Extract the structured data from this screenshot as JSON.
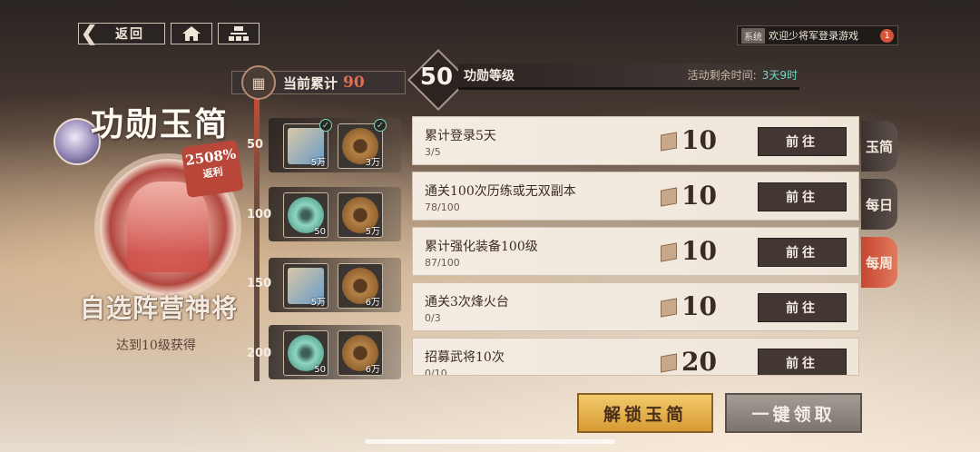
{
  "nav": {
    "back_label": "返回",
    "home_icon": "home-icon",
    "map_icon": "map-icon"
  },
  "notice": {
    "tag": "系统",
    "text": "欢迎少将军登录游戏",
    "badge": "1"
  },
  "event": {
    "title": "功勋玉简",
    "rebate_percent": "2508%",
    "rebate_label": "返利",
    "hero_name": "自选阵营神将",
    "hero_requirement": "达到10级获得"
  },
  "progress": {
    "label": "当前累计",
    "value": "90"
  },
  "levels": [
    {
      "level": "50",
      "rewards": [
        {
          "count": "5万",
          "icon": "scroll-icon",
          "claimed": true
        },
        {
          "count": "3万",
          "icon": "coin-icon",
          "claimed": true
        }
      ]
    },
    {
      "level": "100",
      "rewards": [
        {
          "count": "50",
          "icon": "jade-icon"
        },
        {
          "count": "5万",
          "icon": "coin-icon"
        }
      ]
    },
    {
      "level": "150",
      "rewards": [
        {
          "count": "5万",
          "icon": "scroll-icon"
        },
        {
          "count": "6万",
          "icon": "coin-icon"
        }
      ]
    },
    {
      "level": "200",
      "rewards": [
        {
          "count": "50",
          "icon": "jade-icon"
        },
        {
          "count": "6万",
          "icon": "coin-icon"
        }
      ]
    }
  ],
  "level_header": {
    "level": "50",
    "label": "功勋等级",
    "remain_label": "活动剩余时间:",
    "remain_value": "3天9时"
  },
  "tasks": [
    {
      "name": "累计登录5天",
      "progress": "3/5",
      "points": "10",
      "button": "前往"
    },
    {
      "name": "通关100次历练或无双副本",
      "progress": "78/100",
      "points": "10",
      "button": "前往"
    },
    {
      "name": "累计强化装备100级",
      "progress": "87/100",
      "points": "10",
      "button": "前往"
    },
    {
      "name": "通关3次烽火台",
      "progress": "0/3",
      "points": "10",
      "button": "前往"
    },
    {
      "name": "招募武将10次",
      "progress": "0/10",
      "points": "20",
      "button": "前往"
    }
  ],
  "tabs": [
    {
      "label": "玉简"
    },
    {
      "label": "每日"
    },
    {
      "label": "每周",
      "active": true
    }
  ],
  "buttons": {
    "unlock": "解锁玉简",
    "claim_all": "一键领取"
  },
  "colors": {
    "accent_red": "#c7462f",
    "highlight_cyan": "#6ed7c5",
    "gold": "#e0a845"
  }
}
